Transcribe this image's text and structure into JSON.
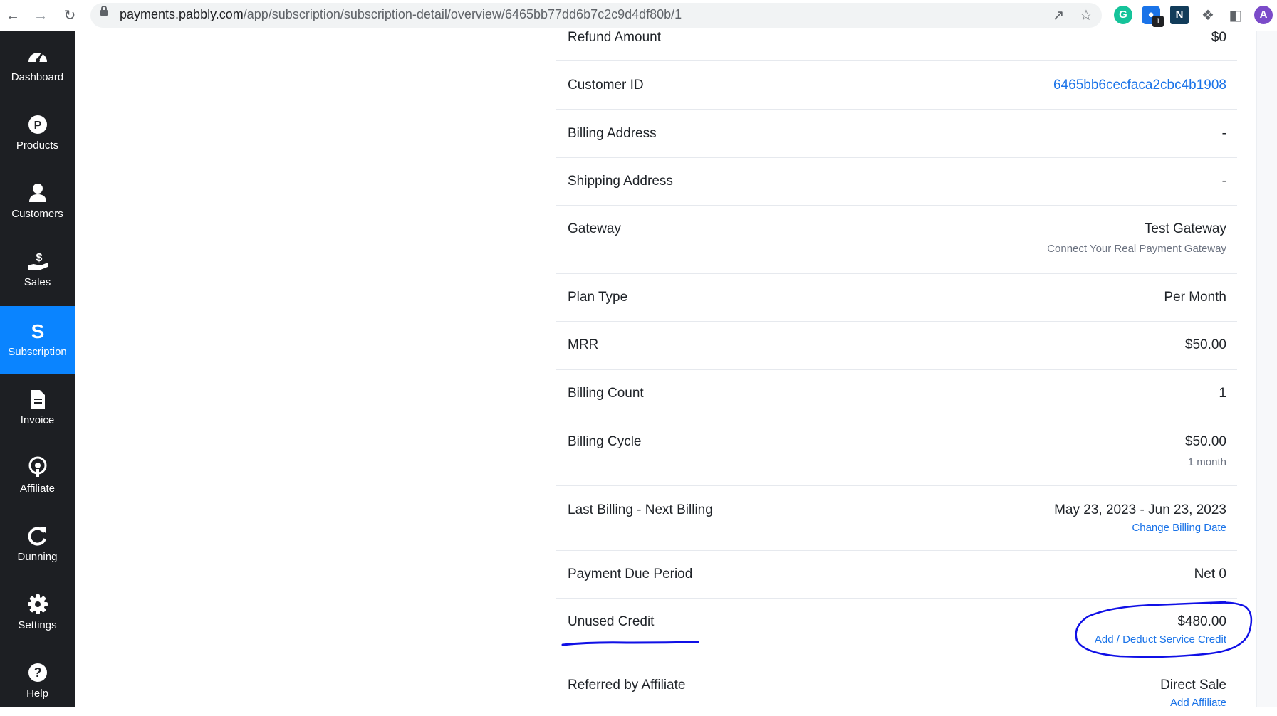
{
  "browser": {
    "url_host": "payments.pabbly.com",
    "url_path": "/app/subscription/subscription-detail/overview/6465bb77dd6b7c2c9d4df80b/1",
    "profile_initial": "A",
    "extension_badge": "1"
  },
  "sidebar": {
    "items": [
      {
        "label": "Dashboard",
        "icon": "gauge-icon"
      },
      {
        "label": "Products",
        "icon": "p-circle-icon"
      },
      {
        "label": "Customers",
        "icon": "user-icon"
      },
      {
        "label": "Sales",
        "icon": "hand-dollar-icon"
      },
      {
        "label": "Subscription",
        "icon": "s-logo-icon"
      },
      {
        "label": "Invoice",
        "icon": "document-icon"
      },
      {
        "label": "Affiliate",
        "icon": "podcast-icon"
      },
      {
        "label": "Dunning",
        "icon": "refresh-icon"
      },
      {
        "label": "Settings",
        "icon": "gear-icon"
      },
      {
        "label": "Help",
        "icon": "question-icon"
      }
    ],
    "active": "Subscription"
  },
  "details": {
    "refund_amount": {
      "label": "Refund Amount",
      "value": "$0"
    },
    "customer_id": {
      "label": "Customer ID",
      "value": "6465bb6cecfaca2cbc4b1908"
    },
    "billing_address": {
      "label": "Billing Address",
      "value": "-"
    },
    "shipping_address": {
      "label": "Shipping Address",
      "value": "-"
    },
    "gateway": {
      "label": "Gateway",
      "value": "Test Gateway",
      "sub": "Connect Your Real Payment Gateway"
    },
    "plan_type": {
      "label": "Plan Type",
      "value": "Per Month"
    },
    "mrr": {
      "label": "MRR",
      "value": "$50.00"
    },
    "billing_count": {
      "label": "Billing Count",
      "value": "1"
    },
    "billing_cycle": {
      "label": "Billing Cycle",
      "value": "$50.00",
      "sub": "1 month"
    },
    "billing_dates": {
      "label": "Last Billing - Next Billing",
      "value": "May 23, 2023 - Jun 23, 2023",
      "link": "Change Billing Date"
    },
    "payment_due": {
      "label": "Payment Due Period",
      "value": "Net 0"
    },
    "unused_credit": {
      "label": "Unused Credit",
      "value": "$480.00",
      "link": "Add / Deduct Service Credit"
    },
    "referred_by": {
      "label": "Referred by Affiliate",
      "value": "Direct Sale",
      "link": "Add Affiliate"
    }
  },
  "colors": {
    "sidebar_bg": "#1d1f23",
    "sidebar_active": "#0a84ff",
    "link": "#1a73e8",
    "annotation": "#1010e6"
  }
}
